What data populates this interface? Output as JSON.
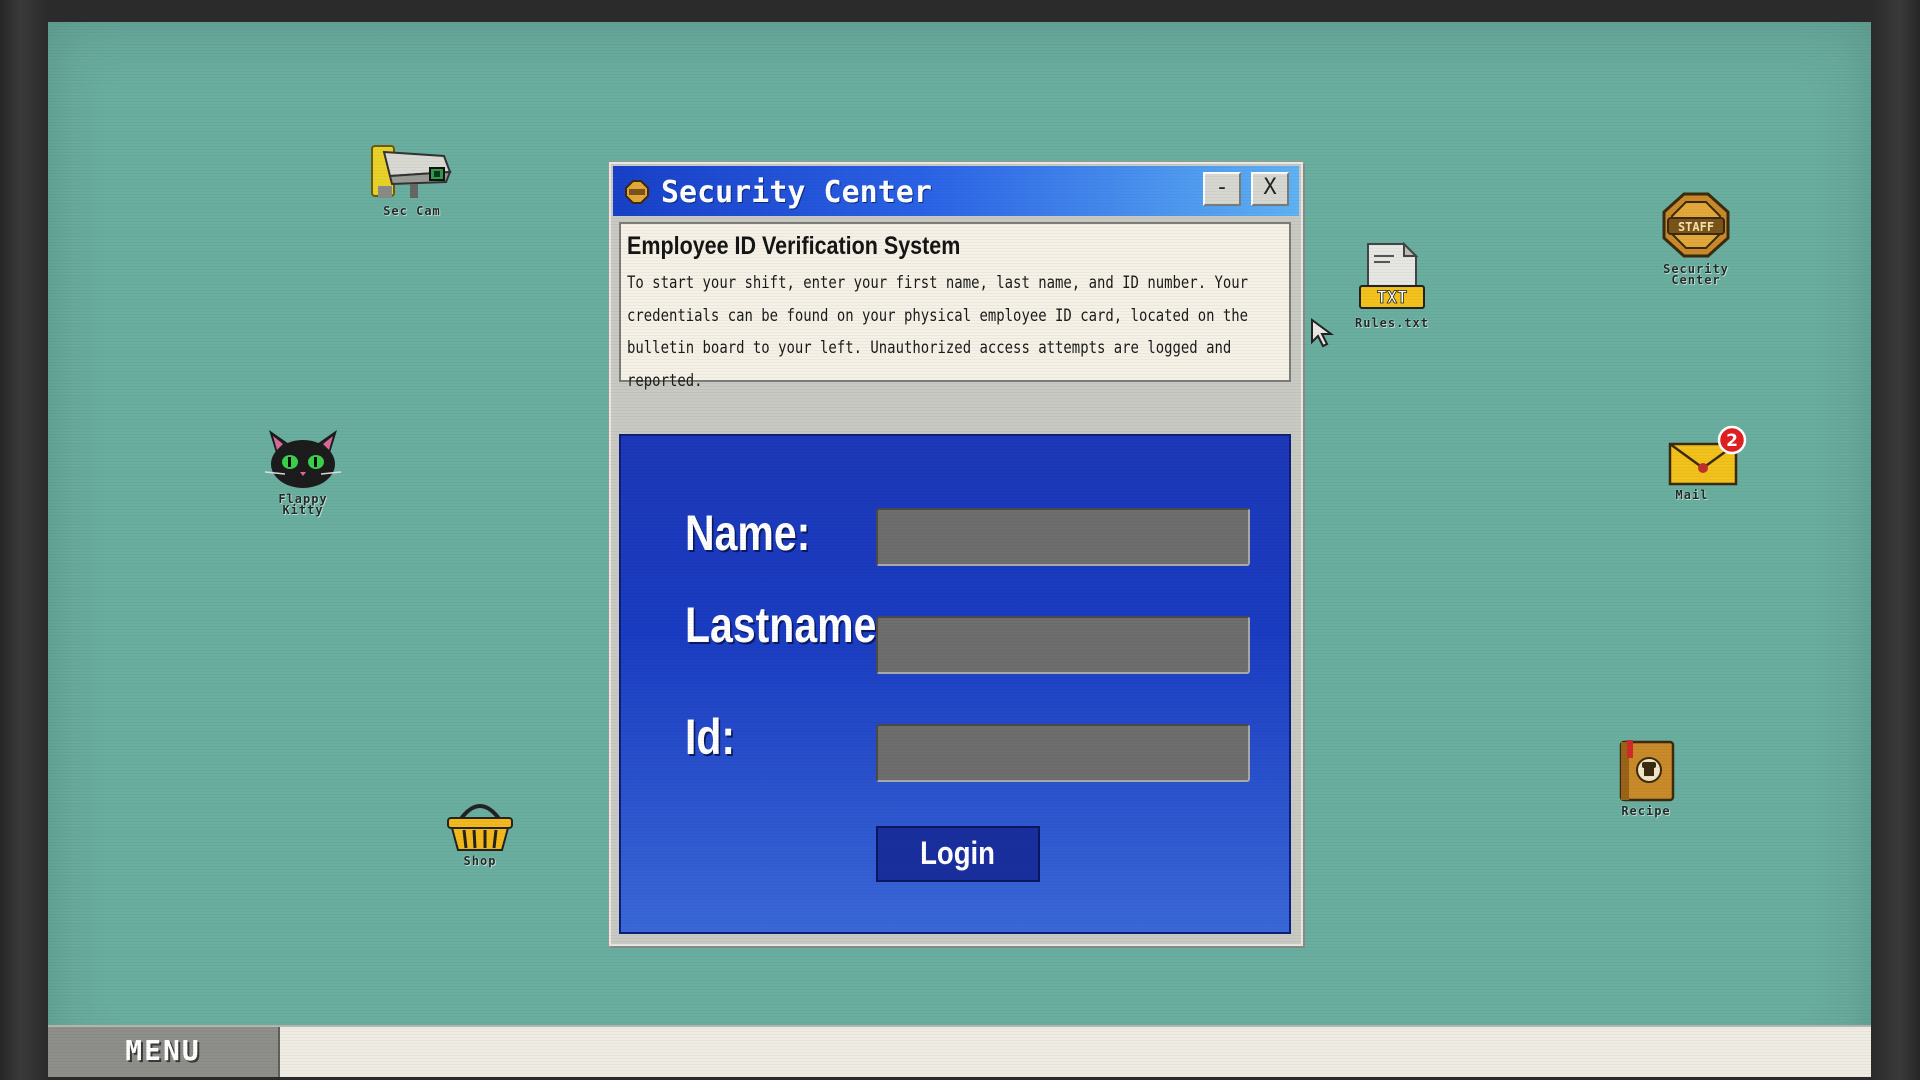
{
  "desktop": {
    "icons": {
      "sec_cam": {
        "label": "Sec Cam"
      },
      "flappy_kitty": {
        "label": "Flappy Kitty"
      },
      "shop": {
        "label": "Shop"
      },
      "rules": {
        "label": "Rules.txt",
        "badge": "TXT"
      },
      "security_center": {
        "label": "Security Center",
        "badge": "STAFF"
      },
      "mail": {
        "label": "Mail",
        "count": "2"
      },
      "recipe": {
        "label": "Recipe"
      }
    }
  },
  "window": {
    "title": "Security Center",
    "minimize_label": "-",
    "close_label": "X",
    "info": {
      "heading": "Employee ID Verification System",
      "body": "To start your shift, enter your first name, last name, and ID number. Your credentials can be found on your physical employee ID card, located on the bulletin board to your left. Unauthorized access attempts are logged and reported."
    },
    "form": {
      "name_label": "Name:",
      "name_value": "",
      "lastname_label": "Lastname:",
      "lastname_value": "",
      "id_label": "Id:",
      "id_value": "",
      "login_label": "Login"
    }
  },
  "taskbar": {
    "menu_label": "MENU"
  },
  "colors": {
    "desktop_bg": "#6aaea0",
    "titlebar_start": "#1840c8",
    "titlebar_end": "#5fb2f4",
    "login_panel": "#1a3cc2",
    "mail_badge": "#e02020"
  }
}
